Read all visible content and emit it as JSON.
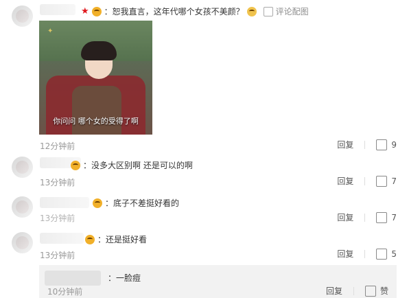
{
  "top_comment": {
    "text": "：恕我直言，这年代哪个女孩不美颜？",
    "link_comment": "评论配图",
    "image_caption": "你问问 哪个女的受得了啊",
    "timestamp": "12分钟前",
    "reply_label": "回复",
    "likes": "9"
  },
  "comments": [
    {
      "text": "：没多大区别啊 还是可以的啊",
      "timestamp": "13分钟前",
      "reply_label": "回复",
      "likes": "7"
    },
    {
      "text": "：底子不差挺好看的",
      "timestamp": "13分钟前",
      "reply_label": "回复",
      "likes": "7"
    },
    {
      "text": "：还是挺好看",
      "timestamp": "13分钟前",
      "reply_label": "回复",
      "likes": "5"
    }
  ],
  "reply": {
    "text": "：一脸痘",
    "timestamp": "10分钟前",
    "reply_label": "回复",
    "like_label": "赞"
  },
  "icons": {
    "brand_red": "#e0181e",
    "icon_names": [
      "red-star-icon",
      "emoji-face-icon",
      "pencil-icon",
      "image-icon",
      "thumb-up-icon"
    ]
  }
}
